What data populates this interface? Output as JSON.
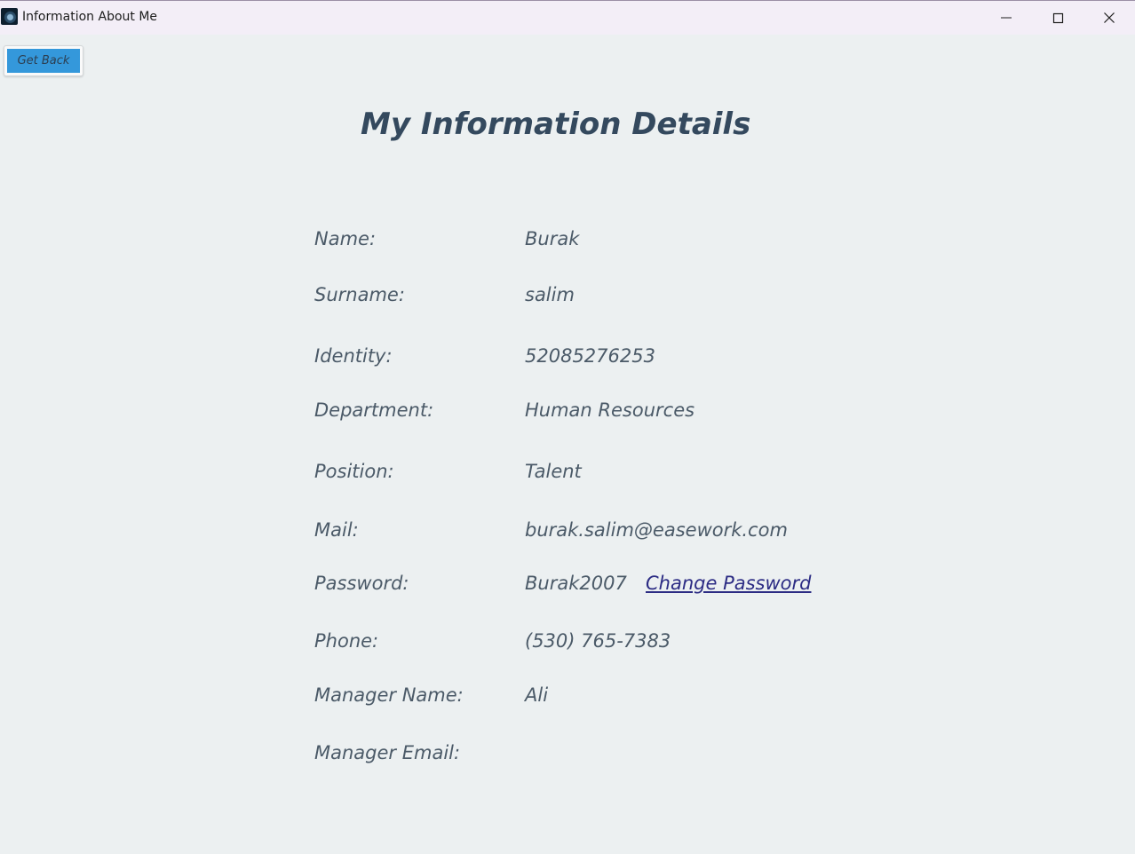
{
  "window": {
    "title": "Information About Me"
  },
  "toolbar": {
    "back_label": "Get Back"
  },
  "page": {
    "title": "My Information Details"
  },
  "details": {
    "name_label": "Name:",
    "name_value": "Burak",
    "surname_label": "Surname:",
    "surname_value": "salim",
    "identity_label": "Identity:",
    "identity_value": "52085276253",
    "department_label": "Department:",
    "department_value": "Human Resources",
    "position_label": "Position:",
    "position_value": "Talent",
    "mail_label": "Mail:",
    "mail_value": "burak.salim@easework.com",
    "password_label": "Password:",
    "password_value": "Burak2007",
    "change_password_label": "Change Password",
    "phone_label": "Phone:",
    "phone_value": "(530) 765-7383",
    "manager_name_label": "Manager Name:",
    "manager_name_value": "Ali",
    "manager_email_label": "Manager Email:",
    "manager_email_value": ""
  },
  "colors": {
    "background": "#ecf0f1",
    "button_accent": "#3498db",
    "heading": "#34495e",
    "text": "#4b5a68",
    "link": "#2c2c84"
  },
  "icons": {
    "app": "app-icon",
    "minimize": "minimize-icon",
    "maximize": "maximize-icon",
    "close": "close-icon"
  }
}
